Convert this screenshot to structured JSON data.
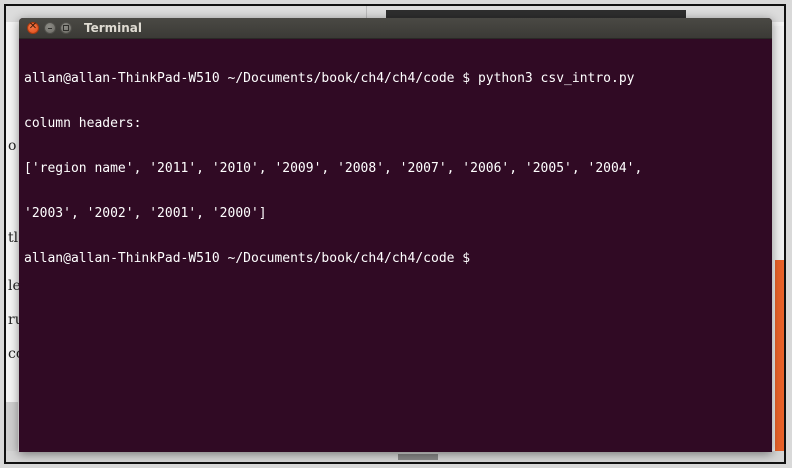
{
  "window": {
    "title": "Terminal",
    "close_glyph": "✕",
    "background_color": "#300a24",
    "text_color": "#ffffff"
  },
  "terminal": {
    "lines": [
      "allan@allan-ThinkPad-W510 ~/Documents/book/ch4/ch4/code $ python3 csv_intro.py",
      "column headers:",
      "['region name', '2011', '2010', '2009', '2008', '2007', '2006', '2005', '2004',",
      "'2003', '2002', '2001', '2000']",
      "allan@allan-ThinkPad-W510 ~/Documents/book/ch4/ch4/code $ "
    ]
  },
  "background_document": {
    "fragments": [
      "o",
      "tl",
      "le",
      "ru",
      "cc"
    ]
  },
  "icons": [
    "close-icon",
    "minimize-icon",
    "maximize-icon"
  ]
}
